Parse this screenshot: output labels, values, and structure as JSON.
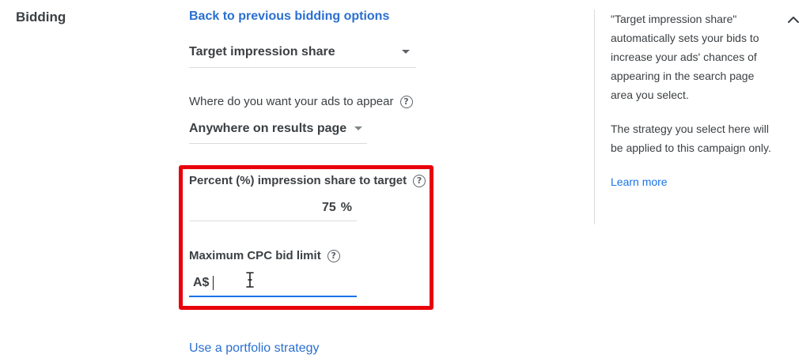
{
  "section": {
    "title": "Bidding"
  },
  "bidding": {
    "back_link": "Back to previous bidding options",
    "strategy_dropdown": {
      "value": "Target impression share"
    },
    "where_label": "Where do you want your ads to appear",
    "where_dropdown": {
      "value": "Anywhere on results page"
    },
    "percent_label": "Percent (%) impression share to target",
    "percent_value": "75",
    "percent_unit": "%",
    "cpc_label": "Maximum CPC bid limit",
    "cpc_prefix": "A$",
    "cpc_value": "",
    "portfolio_link": "Use a portfolio strategy"
  },
  "info": {
    "paragraph1": "\"Target impression share\" automatically sets your bids to increase your ads' chances of appearing in the search page area you select.",
    "paragraph2": "The strategy you select here will be applied to this campaign only.",
    "learn_more": "Learn more"
  },
  "colors": {
    "link": "#1a73e8",
    "highlight": "#e8000b",
    "focus_underline": "#1a73e8"
  },
  "icons": {
    "help": "help-circle-icon",
    "dropdown": "caret-down-icon",
    "collapse": "chevron-up-icon",
    "text_cursor": "i-beam-cursor-icon"
  }
}
